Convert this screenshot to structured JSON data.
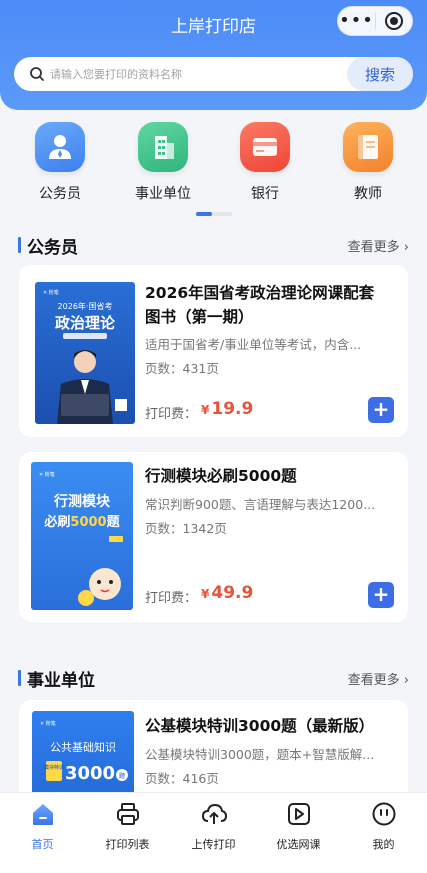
{
  "app": {
    "title": "上岸打印店"
  },
  "capsule": {
    "menu": "•••"
  },
  "search": {
    "placeholder": "请输入您要打印的资料名称",
    "button": "搜索"
  },
  "categories": [
    {
      "label": "公务员",
      "icon": "civil-servant-icon",
      "color": "#4a8ff5"
    },
    {
      "label": "事业单位",
      "icon": "building-icon",
      "color": "#3cc28a"
    },
    {
      "label": "银行",
      "icon": "bank-card-icon",
      "color": "#f3584a"
    },
    {
      "label": "教师",
      "icon": "teacher-book-icon",
      "color": "#f6953a"
    }
  ],
  "sections": [
    {
      "title": "公务员",
      "more": "查看更多",
      "books": [
        {
          "title": "2026年国省考政治理论网课配套图书（第一期）",
          "desc": "适用于国省考/事业单位等考试，内含...",
          "pages": "页数：431页",
          "price_label": "打印费：",
          "currency": "¥",
          "price": "19.9",
          "cover": {
            "year": "2026年·国省考",
            "main": "政治理论"
          }
        },
        {
          "title": "行测模块必刷5000题",
          "desc": "常识判断900题、言语理解与表达1200...",
          "pages": "页数：1342页",
          "price_label": "打印费：",
          "currency": "¥",
          "price": "49.9",
          "cover": {
            "line1": "行测模块",
            "line2a": "必刷",
            "line2b": "5000",
            "line2c": "题"
          }
        }
      ]
    },
    {
      "title": "事业单位",
      "more": "查看更多",
      "books": [
        {
          "title": "公基模块特训3000题（最新版）",
          "desc": "公基模块特训3000题，题本+智慧版解...",
          "pages": "页数：416页",
          "cover": {
            "line1": "公共基础知识",
            "tag": "模块特训",
            "num": "3000",
            "unit": "题"
          }
        }
      ]
    }
  ],
  "tabs": [
    {
      "label": "首页",
      "icon": "home-icon"
    },
    {
      "label": "打印列表",
      "icon": "printer-icon"
    },
    {
      "label": "上传打印",
      "icon": "cloud-upload-icon"
    },
    {
      "label": "优选网课",
      "icon": "video-play-icon"
    },
    {
      "label": "我的",
      "icon": "profile-face-icon"
    }
  ],
  "colors": {
    "primary": "#3d74e8",
    "price": "#e8543a",
    "header": "#4d8bf7"
  }
}
